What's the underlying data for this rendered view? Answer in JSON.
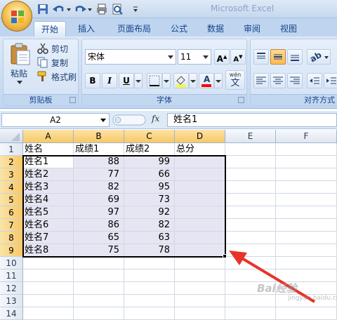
{
  "title_bar": {
    "title": "Microsoft Excel"
  },
  "ribbon_tabs": [
    "开始",
    "插入",
    "页面布局",
    "公式",
    "数据",
    "审阅",
    "视图"
  ],
  "active_tab": "开始",
  "clipboard": {
    "paste_label": "粘贴",
    "cut_label": "剪切",
    "copy_label": "复制",
    "format_painter_label": "格式刷",
    "group_label": "剪贴板"
  },
  "font": {
    "font_name": "宋体",
    "font_size": "11",
    "grow_label": "A",
    "shrink_label": "A",
    "bold": "B",
    "italic": "I",
    "underline": "U",
    "font_color_label": "A",
    "wen_label": "wén",
    "wen_char": "文",
    "group_label": "字体"
  },
  "alignment": {
    "group_label": "对齐方式"
  },
  "formula_bar": {
    "name_box": "A2",
    "fx_label": "fx",
    "formula": "姓名1"
  },
  "grid": {
    "columns": [
      "A",
      "B",
      "C",
      "D",
      "E",
      "F"
    ],
    "selected_columns": [
      "A",
      "B",
      "C",
      "D"
    ],
    "row_numbers": [
      "1",
      "2",
      "3",
      "4",
      "5",
      "6",
      "7",
      "8",
      "9",
      "10",
      "11",
      "12",
      "13",
      "14"
    ],
    "selected_rows": [
      "2",
      "3",
      "4",
      "5",
      "6",
      "7",
      "8",
      "9"
    ],
    "header_row": [
      "姓名",
      "成绩1",
      "成绩2",
      "总分"
    ],
    "rows": [
      [
        "姓名1",
        "88",
        "99"
      ],
      [
        "姓名2",
        "77",
        "66"
      ],
      [
        "姓名3",
        "82",
        "95"
      ],
      [
        "姓名4",
        "69",
        "73"
      ],
      [
        "姓名5",
        "97",
        "92"
      ],
      [
        "姓名6",
        "86",
        "82"
      ],
      [
        "姓名7",
        "65",
        "63"
      ],
      [
        "姓名8",
        "75",
        "78"
      ]
    ]
  },
  "colors": {
    "selection_fill": "#e6e6f3",
    "header_selected": "#f8c864",
    "arrow": "#e8332a"
  },
  "watermark": {
    "text": "Bai经验",
    "sub": "jingyan.baidu.com"
  }
}
